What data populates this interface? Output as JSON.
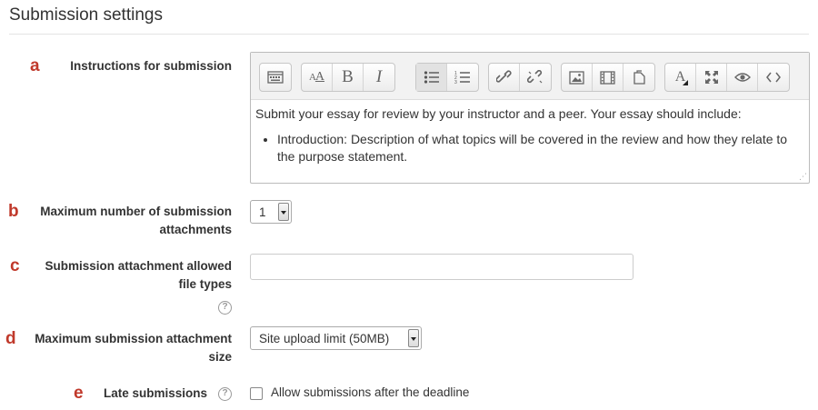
{
  "section": {
    "title": "Submission settings"
  },
  "fields": {
    "instructions": {
      "marker": "a",
      "label": "Instructions for submission",
      "content": {
        "paragraph": "Submit your essay for review by your instructor and a peer.  Your essay should include:",
        "bullet_line1": "Introduction: Description of what topics will be covered in the review and how they relate to",
        "bullet_line2": "the purpose statement."
      },
      "toolbar_icons": [
        [
          "toolbar-toggle-icon"
        ],
        [
          "font-size-icon",
          "bold-icon",
          "italic-icon"
        ],
        [
          "unordered-list-icon",
          "ordered-list-icon"
        ],
        [
          "link-icon",
          "unlink-icon"
        ],
        [
          "image-icon",
          "media-icon",
          "manage-files-icon"
        ],
        [
          "text-color-icon",
          "fullscreen-icon",
          "preview-icon",
          "html-icon"
        ]
      ]
    },
    "max_attachments": {
      "marker": "b",
      "label_line1": "Maximum number of submission",
      "label_line2": "attachments",
      "value": "1"
    },
    "file_types": {
      "marker": "c",
      "label_line1": "Submission attachment allowed",
      "label_line2": "file types",
      "value": "",
      "help": "?"
    },
    "max_size": {
      "marker": "d",
      "label_line1": "Maximum submission attachment",
      "label_line2": "size",
      "value": "Site upload limit (50MB)"
    },
    "late": {
      "marker": "e",
      "label": "Late submissions",
      "help": "?",
      "checkbox_label": "Allow submissions after the deadline",
      "checked": false
    }
  },
  "colors": {
    "marker": "#c0392b",
    "text": "#333333",
    "toolbar_bg": "#f2f2f2"
  }
}
